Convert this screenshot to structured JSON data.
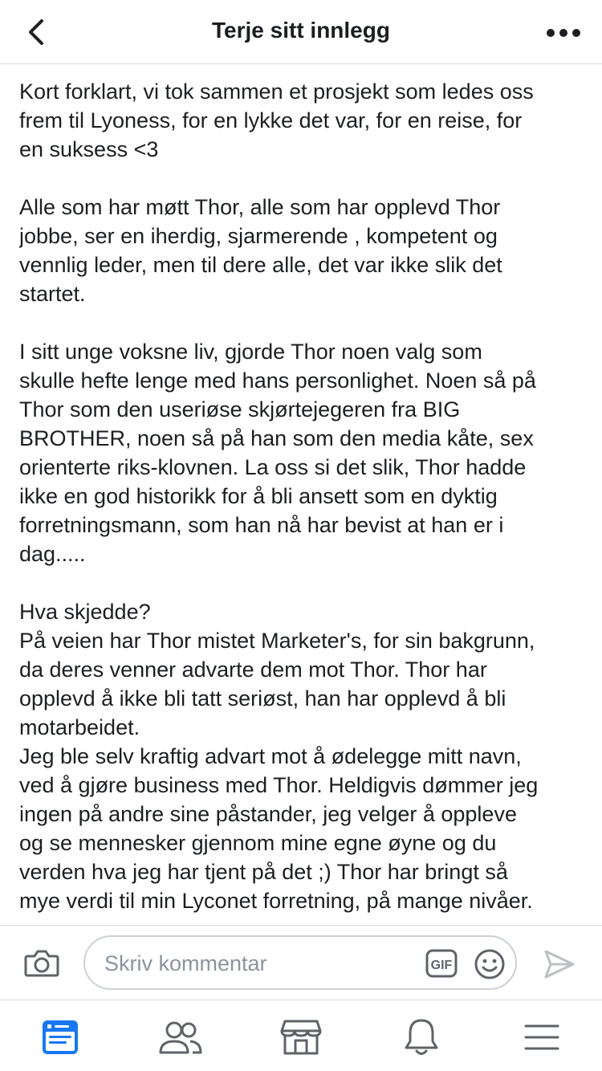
{
  "header": {
    "title": "Terje sitt innlegg"
  },
  "post": {
    "paragraphs": [
      "Kort forklart, vi tok sammen et prosjekt som ledes oss\nfrem til Lyoness, for en lykke det var, for en reise, for\nen suksess <3",
      "Alle som har møtt Thor, alle som har opplevd Thor\njobbe, ser en iherdig, sjarmerende , kompetent og\nvennlig leder, men til dere alle, det var ikke slik det\nstartet.",
      "I sitt unge voksne liv, gjorde Thor noen valg som\nskulle hefte lenge med hans personlighet. Noen så på\nThor som den useriøse skjørtejegeren fra BIG\nBROTHER, noen så på han som den media kåte, sex\norienterte riks-klovnen. La oss si det slik, Thor hadde\nikke en god historikk for å bli ansett som en dyktig\nforretningsmann, som han nå har bevist at han er i\ndag.....",
      "Hva skjedde?\nPå veien har Thor mistet Marketer's, for sin bakgrunn,\nda deres venner advarte dem mot Thor. Thor har\nopplevd å ikke bli tatt seriøst, han har opplevd å bli\nmotarbeidet.\nJeg ble selv kraftig advart mot å ødelegge mitt navn,\nved å gjøre business med Thor. Heldigvis dømmer jeg\ningen på andre sine påstander, jeg velger å oppleve\nog se mennesker gjennom mine egne øyne og du\nverden hva jeg har tjent på det ;) Thor har bringt så\nmye verdi til min Lyconet forretning, på mange nivåer."
    ]
  },
  "composer": {
    "placeholder": "Skriv kommentar",
    "gif_label": "GIF"
  },
  "icons": {
    "back": "chevron-left-icon",
    "more": "more-dots-icon",
    "camera": "camera-icon",
    "gif": "gif-icon",
    "emoji": "emoji-icon",
    "send": "send-icon",
    "tabs": [
      "news-feed-icon",
      "friends-icon",
      "marketplace-icon",
      "notifications-icon",
      "menu-icon"
    ]
  },
  "colors": {
    "accent": "#1877f2",
    "icon_gray": "#5f6368",
    "border": "#ccd0d5",
    "placeholder": "#8d949e"
  }
}
